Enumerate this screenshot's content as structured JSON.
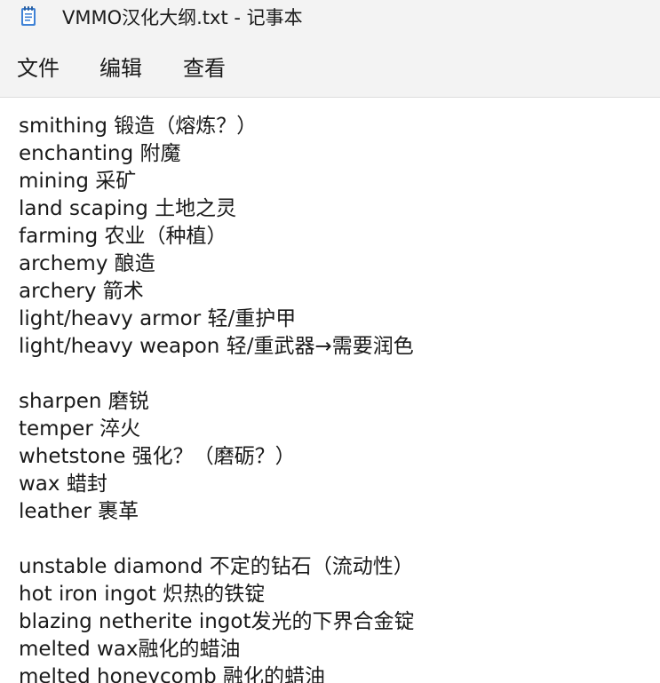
{
  "window": {
    "title": "VMMO汉化大纲.txt - 记事本"
  },
  "menu": {
    "file": "文件",
    "edit": "编辑",
    "view": "查看"
  },
  "editor": {
    "lines": [
      "smithing 锻造（熔炼？）",
      "enchanting 附魔",
      "mining 采矿",
      "land scaping 土地之灵",
      "farming 农业（种植）",
      "archemy 酿造",
      "archery 箭术",
      "light/heavy armor 轻/重护甲",
      "light/heavy weapon 轻/重武器→需要润色",
      "",
      "sharpen 磨锐",
      "temper 淬火",
      "whetstone 强化？（磨砺？）",
      "wax 蜡封",
      "leather 裹革",
      "",
      "unstable diamond 不定的钻石（流动性）",
      "hot iron ingot 炽热的铁锭",
      "blazing netherite ingot发光的下界合金锭",
      "melted wax融化的蜡油",
      "melted honeycomb 融化的蜡油"
    ]
  },
  "colors": {
    "chrome_bg": "#f3f3f3",
    "editor_bg": "#ffffff",
    "text": "#1a1a1a",
    "icon_blue": "#3f82d6"
  },
  "icons": {
    "app": "notepad-icon"
  }
}
